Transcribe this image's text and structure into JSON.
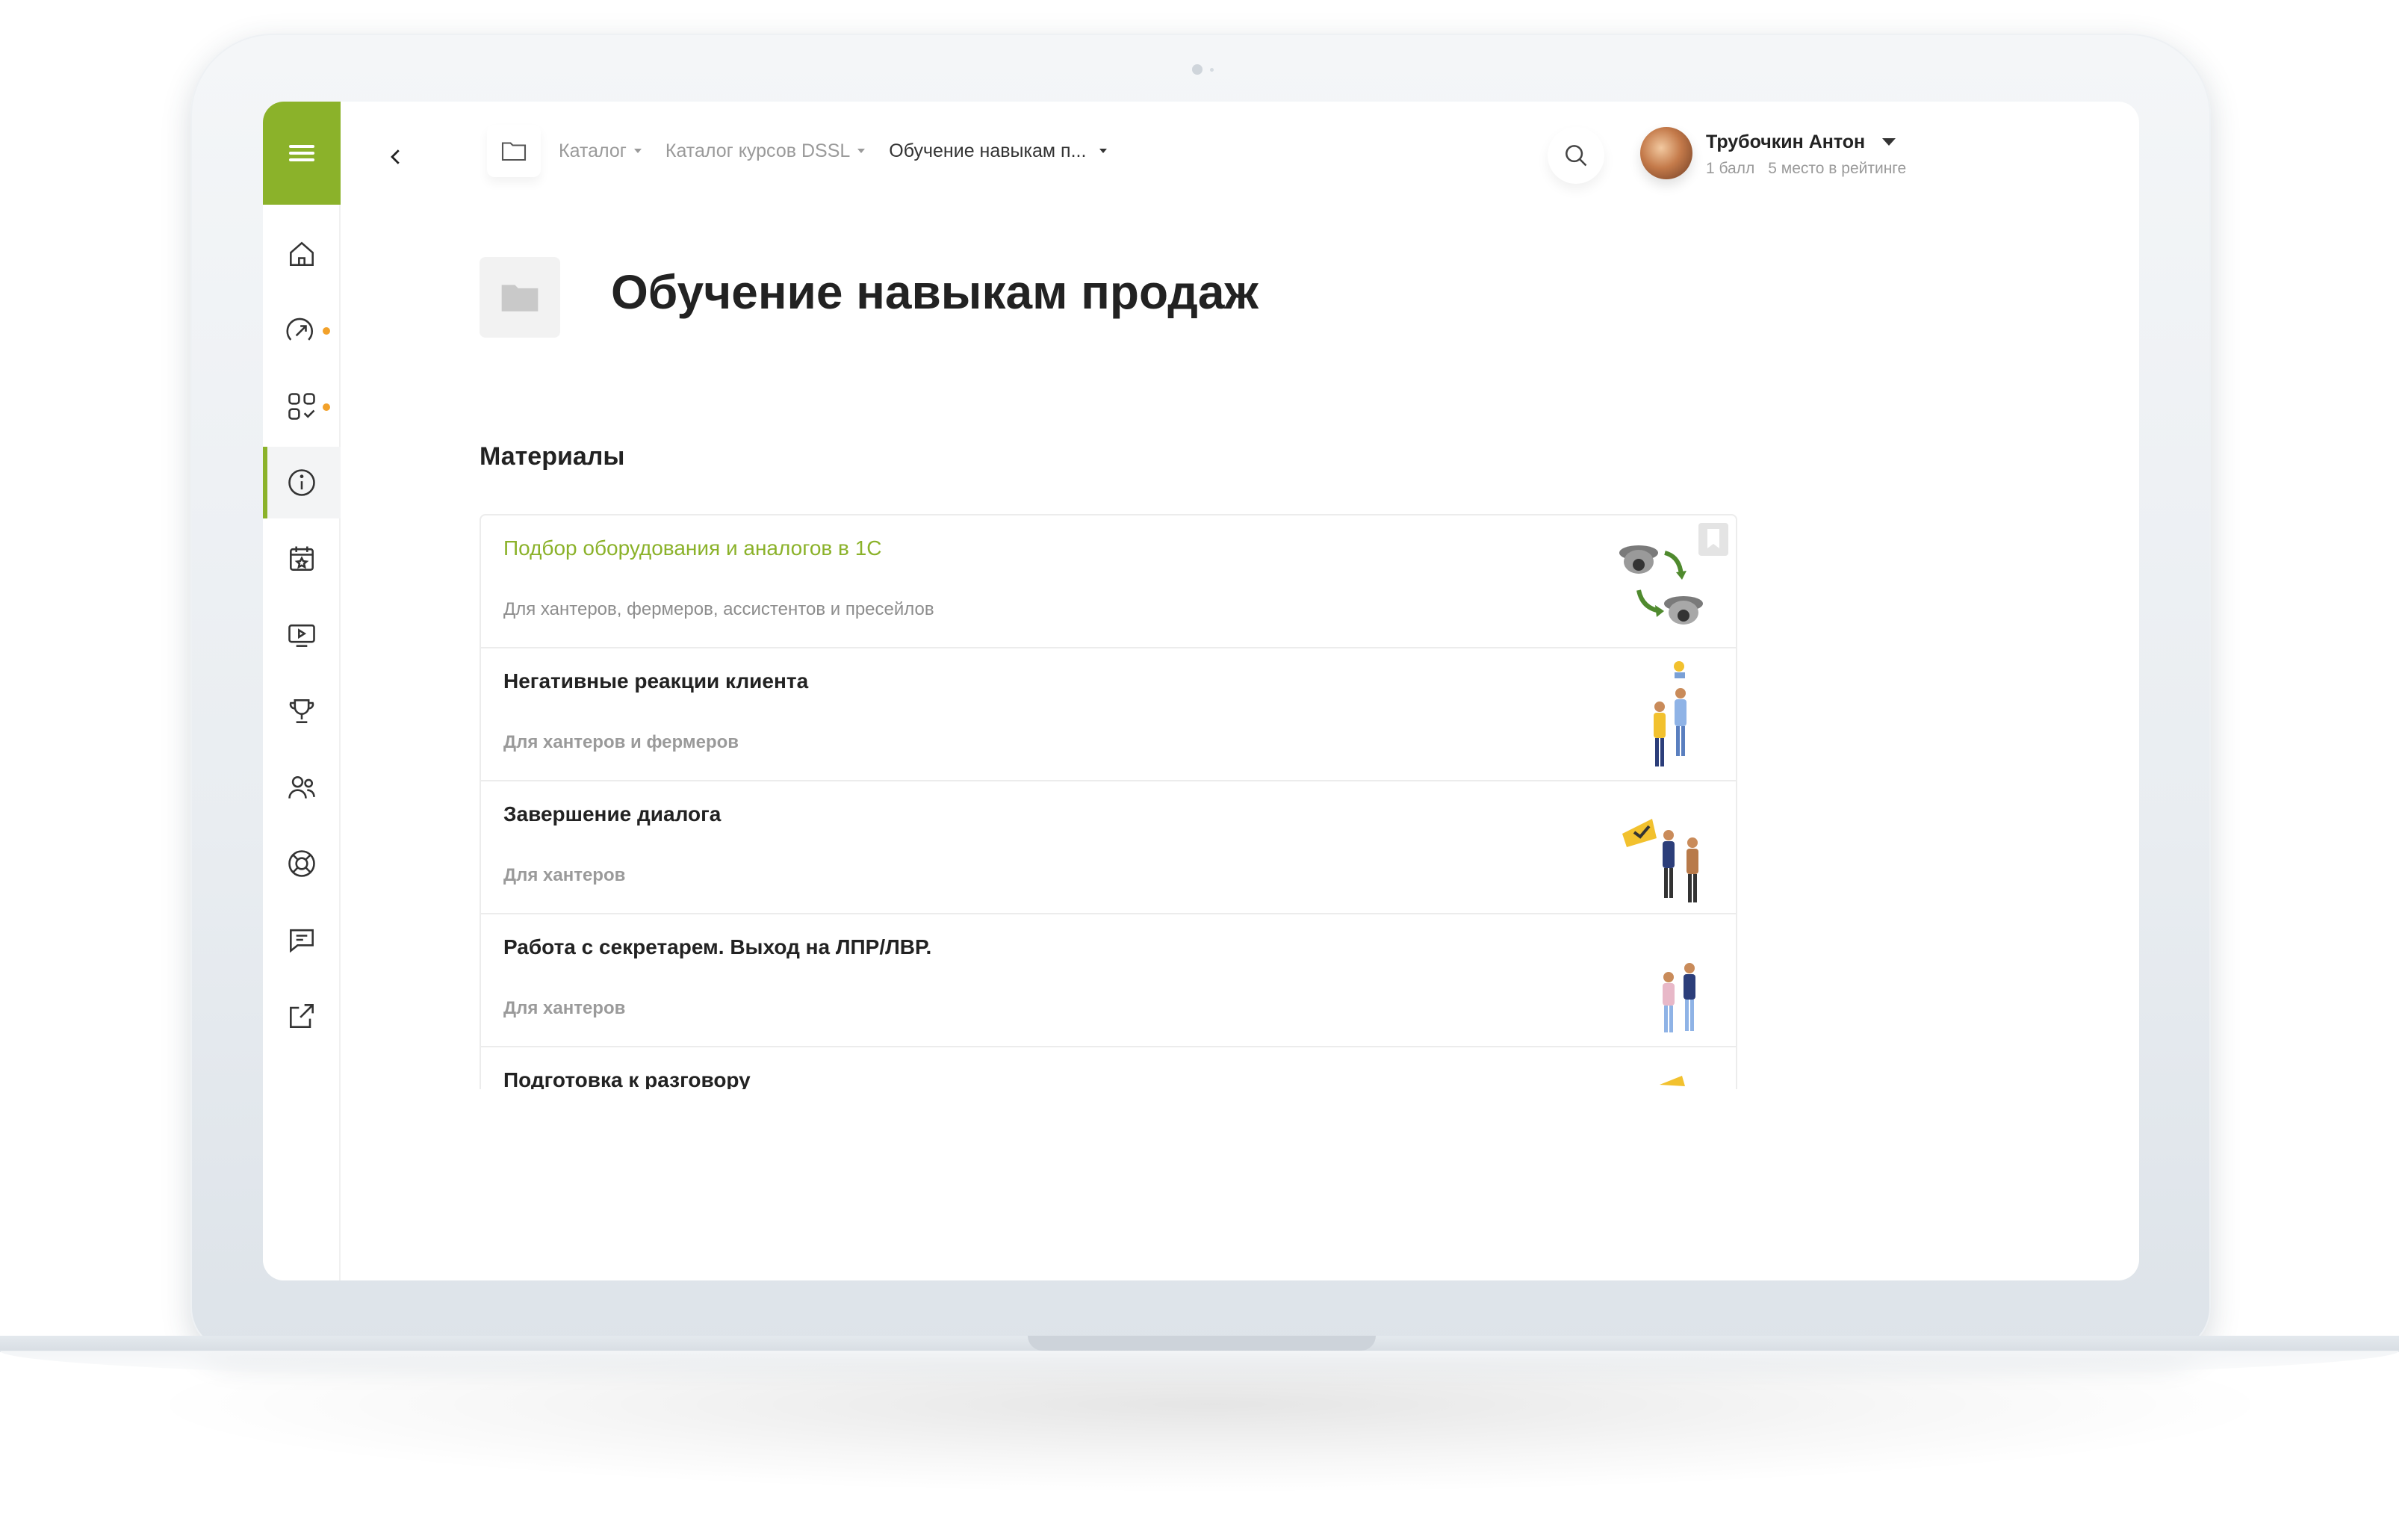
{
  "sidebar": {
    "menu_icon": "hamburger-icon",
    "items": [
      {
        "icon": "home-icon",
        "active": false,
        "dot": false
      },
      {
        "icon": "compass-icon",
        "active": false,
        "dot": true
      },
      {
        "icon": "apps-check-icon",
        "active": false,
        "dot": true
      },
      {
        "icon": "info-icon",
        "active": true,
        "dot": false
      },
      {
        "icon": "calendar-star-icon",
        "active": false,
        "dot": false
      },
      {
        "icon": "video-icon",
        "active": false,
        "dot": false
      },
      {
        "icon": "trophy-icon",
        "active": false,
        "dot": false
      },
      {
        "icon": "users-icon",
        "active": false,
        "dot": false
      },
      {
        "icon": "support-ring-icon",
        "active": false,
        "dot": false
      },
      {
        "icon": "chat-icon",
        "active": false,
        "dot": false
      },
      {
        "icon": "external-link-icon",
        "active": false,
        "dot": false
      }
    ]
  },
  "header": {
    "breadcrumb": [
      {
        "label": "Каталог"
      },
      {
        "label": "Каталог курсов DSSL"
      },
      {
        "label": "Обучение навыкам п..."
      }
    ],
    "user": {
      "name": "Трубочкин Антон",
      "points": "1 балл",
      "rank": "5 место в рейтинге"
    }
  },
  "page": {
    "title": "Обучение навыкам продаж",
    "section_title": "Материалы"
  },
  "materials": [
    {
      "title": "Подбор оборудования и аналогов в 1С",
      "subtitle": "Для хантеров, фермеров, ассистентов и пресейлов",
      "image": "cameras-exchange"
    },
    {
      "title": "Негативные реакции клиента",
      "subtitle": "Для хантеров и фермеров",
      "image": "people-talking"
    },
    {
      "title": "Завершение диалога",
      "subtitle": "Для хантеров",
      "image": "handshake"
    },
    {
      "title": "Работа с секретарем. Выход на ЛПР/ЛВР.",
      "subtitle": "Для хантеров",
      "image": "two-people"
    },
    {
      "title": "Подготовка к разговору",
      "subtitle": "",
      "image": "preparation"
    }
  ],
  "colors": {
    "accent": "#8bb22a",
    "notification_dot": "#f2a12a"
  }
}
